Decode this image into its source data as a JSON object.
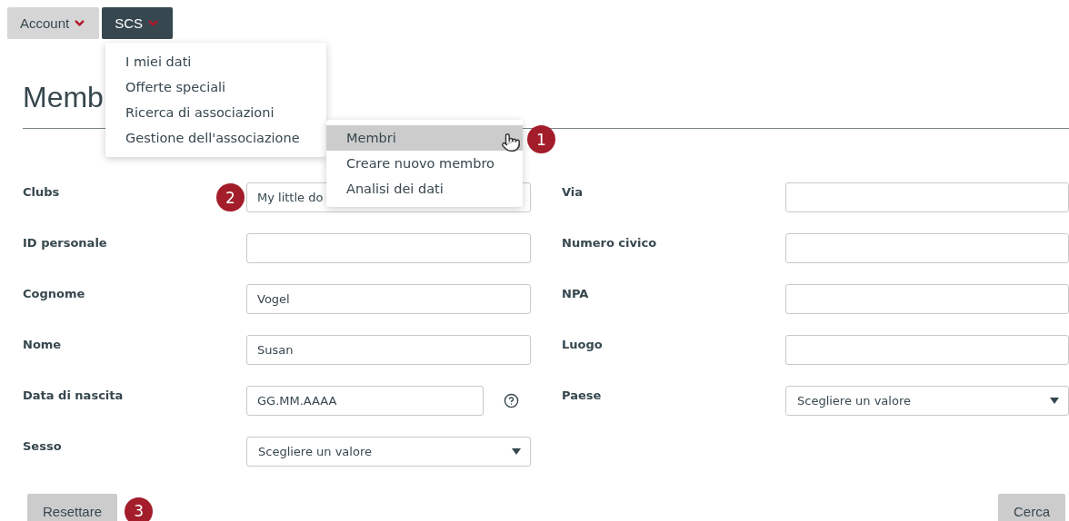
{
  "nav": [
    {
      "label": "Account",
      "selected": false
    },
    {
      "label": "SCS",
      "selected": true
    }
  ],
  "menu": [
    {
      "label": "I miei dati"
    },
    {
      "label": "Offerte speciali"
    },
    {
      "label": "Ricerca di associazioni"
    },
    {
      "label": "Gestione dell'associazione"
    }
  ],
  "submenu": {
    "badge": "1",
    "items": [
      {
        "label": "Membri",
        "selected": true
      },
      {
        "label": "Creare nuovo membro",
        "selected": false
      },
      {
        "label": "Analisi dei dati",
        "selected": false
      }
    ]
  },
  "title": "Memb",
  "form": {
    "left": [
      {
        "label": "Clubs",
        "kind": "text",
        "value": "My little do",
        "badge": "2"
      },
      {
        "label": "ID personale",
        "kind": "text"
      },
      {
        "label": "Cognome",
        "kind": "text",
        "value": "Vogel"
      },
      {
        "label": "Nome",
        "kind": "text",
        "value": "Susan"
      },
      {
        "label": "Data di nascita",
        "kind": "date",
        "placeholder": "GG.MM.AAAA"
      },
      {
        "label": "Sesso",
        "kind": "select",
        "value": "Scegliere un valore"
      }
    ],
    "right": [
      {
        "label": "Via",
        "kind": "text"
      },
      {
        "label": "Numero civico",
        "kind": "text"
      },
      {
        "label": "NPA",
        "kind": "text"
      },
      {
        "label": "Luogo",
        "kind": "text"
      },
      {
        "label": "Paese",
        "kind": "select",
        "value": "Scegliere un valore"
      }
    ]
  },
  "reset": {
    "label": "Resettare",
    "badge": "3"
  },
  "search": {
    "label": "Cerca"
  }
}
